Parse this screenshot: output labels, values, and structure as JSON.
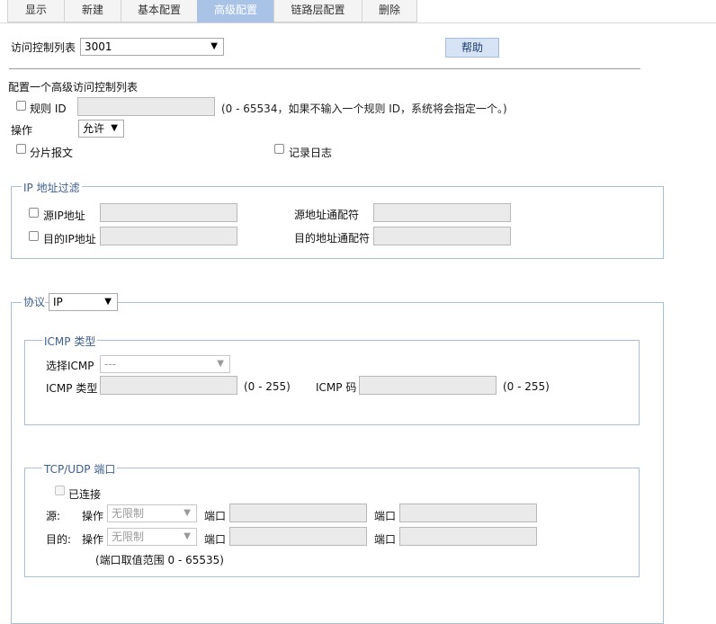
{
  "tabs": [
    {
      "label": "显示",
      "active": false
    },
    {
      "label": "新建",
      "active": false
    },
    {
      "label": "基本配置",
      "active": false
    },
    {
      "label": "高级配置",
      "active": true
    },
    {
      "label": "链路层配置",
      "active": false
    },
    {
      "label": "删除",
      "active": false
    }
  ],
  "acl": {
    "label": "访问控制列表",
    "value": "3001",
    "help_label": "帮助"
  },
  "section_title": "配置一个高级访问控制列表",
  "rule": {
    "label": "规则 ID",
    "value": "",
    "hint": "(0 - 65534，如果不输入一个规则 ID，系统将会指定一个。)"
  },
  "operation": {
    "label": "操作",
    "value": "允许"
  },
  "fragment_label": "分片报文",
  "log_label": "记录日志",
  "ip_filter": {
    "legend": "IP 地址过滤",
    "src_ip_label": "源IP地址",
    "src_wildcard_label": "源地址通配符",
    "dst_ip_label": "目的IP地址",
    "dst_wildcard_label": "目的地址通配符"
  },
  "protocol": {
    "label": "协议",
    "value": "IP"
  },
  "icmp": {
    "legend": "ICMP 类型",
    "select_label": "选择ICMP",
    "select_value": "---",
    "type_label": "ICMP 类型",
    "type_range": "(0 - 255)",
    "code_label": "ICMP 码",
    "code_range": "(0 - 255)"
  },
  "tcpudp": {
    "legend": "TCP/UDP 端口",
    "established_label": "已连接",
    "src_label": "源:",
    "dst_label": "目的:",
    "op_label": "操作",
    "op_value": "无限制",
    "port_label": "端口",
    "port_range_hint": "(端口取值范围 0 - 65535)"
  },
  "icons": {
    "dropdown": "triangle-down-icon",
    "checkbox": "checkbox-unchecked-icon"
  },
  "colors": {
    "active_tab": "#a9c3e6",
    "fieldset_border": "#a8bfd8",
    "legend_text": "#3d5f8f",
    "help_button": "#d6e3f5"
  }
}
